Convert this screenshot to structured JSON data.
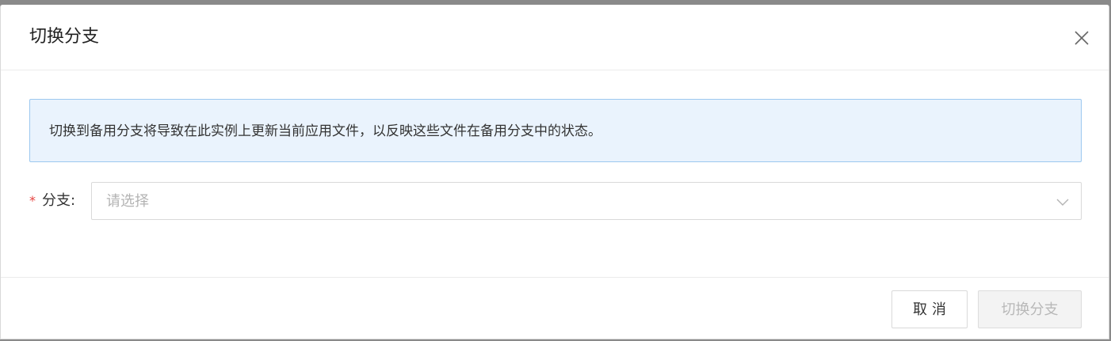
{
  "dialog": {
    "title": "切换分支",
    "close_icon": "close-icon"
  },
  "alert": {
    "message": "切换到备用分支将导致在此实例上更新当前应用文件，以反映这些文件在备用分支中的状态。"
  },
  "form": {
    "required_mark": "*",
    "branch_label": "分支:",
    "branch_select": {
      "placeholder": "请选择",
      "value": "",
      "icon": "chevron-down-icon"
    }
  },
  "footer": {
    "cancel_label": "取消",
    "switch_label": "切换分支",
    "switch_disabled": true
  },
  "colors": {
    "required": "#e64340",
    "alert_bg": "#eaf3fd",
    "alert_border": "#9cc8ef",
    "disabled_text": "#b8b8b8"
  }
}
